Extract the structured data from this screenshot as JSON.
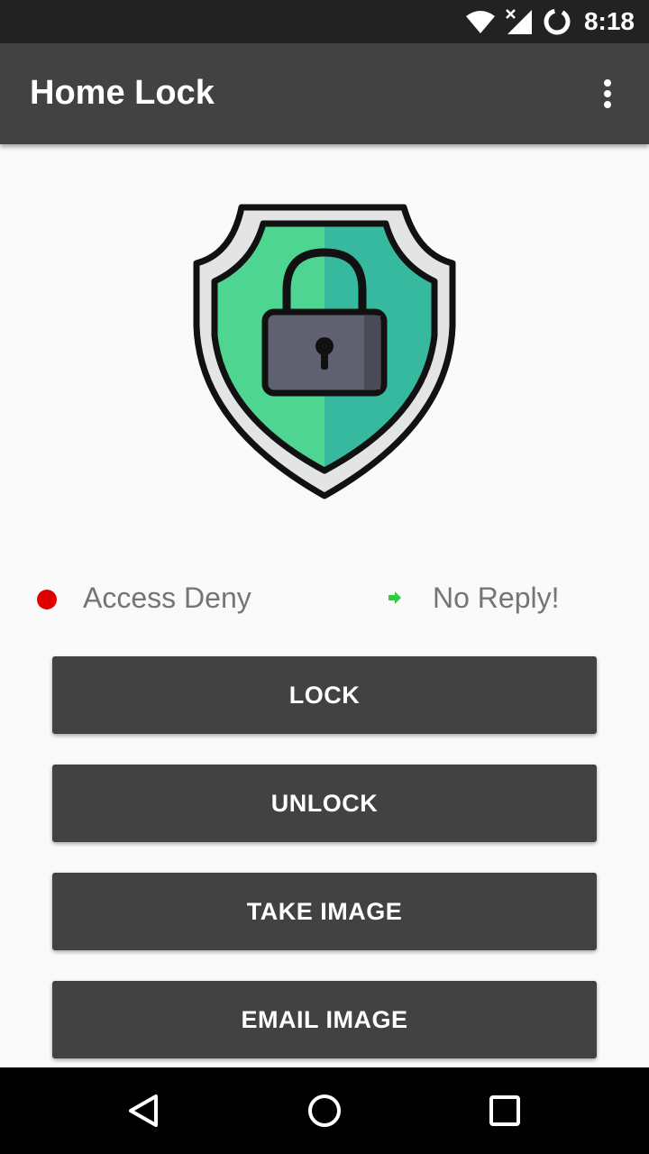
{
  "status_bar": {
    "time": "8:18",
    "icons": [
      "wifi-icon",
      "no-signal-icon",
      "battery-charging-icon"
    ]
  },
  "app_bar": {
    "title": "Home Lock",
    "overflow_icon": "more-vert-icon"
  },
  "hero": {
    "icon": "shield-lock-icon",
    "colors": {
      "shield_left": "#4fd592",
      "shield_right": "#37b9a0",
      "lock_body": "#5f6170"
    }
  },
  "status": {
    "access_indicator_color": "#e00000",
    "access_label": "Access Deny",
    "reply_indicator_color": "#2ecc40",
    "reply_label": "No Reply!"
  },
  "actions": {
    "lock": "LOCK",
    "unlock": "UNLOCK",
    "take_image": "TAKE IMAGE",
    "email_image": "EMAIL IMAGE"
  },
  "nav_bar": {
    "icons": [
      "back-icon",
      "home-icon",
      "recents-icon"
    ]
  },
  "theme": {
    "primary": "#424242",
    "status_bar": "#222222",
    "background": "#fafafa"
  }
}
